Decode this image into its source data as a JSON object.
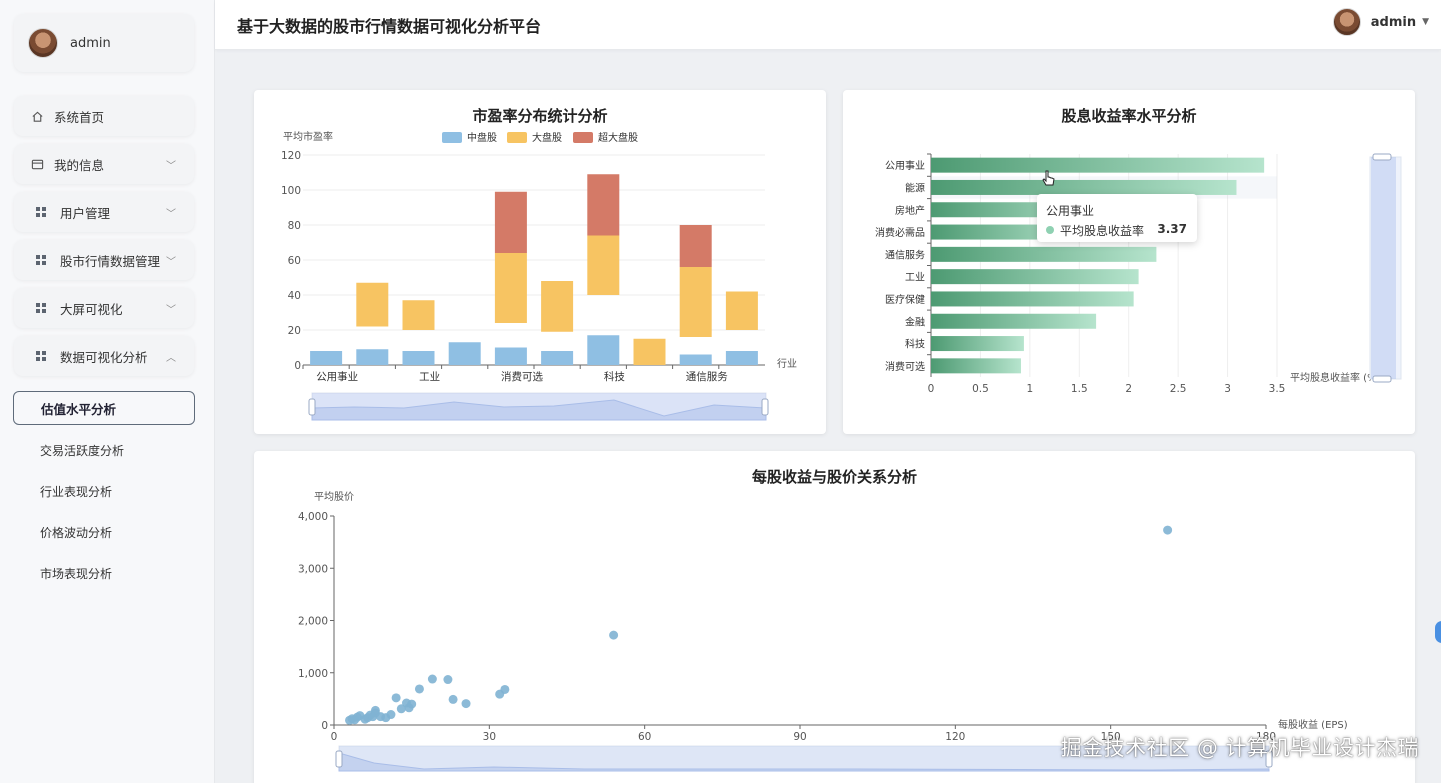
{
  "app": {
    "title": "基于大数据的股市行情数据可视化分析平台"
  },
  "user": {
    "name": "admin"
  },
  "sidebar": {
    "items": [
      {
        "label": "系统首页"
      },
      {
        "label": "我的信息"
      },
      {
        "label": "用户管理"
      },
      {
        "label": "股市行情数据管理"
      },
      {
        "label": "大屏可视化"
      },
      {
        "label": "数据可视化分析"
      }
    ],
    "subitems": [
      {
        "label": "估值水平分析"
      },
      {
        "label": "交易活跃度分析"
      },
      {
        "label": "行业表现分析"
      },
      {
        "label": "价格波动分析"
      },
      {
        "label": "市场表现分析"
      }
    ]
  },
  "tooltip": {
    "title": "公用事业",
    "label": "平均股息收益率",
    "value": "3.37"
  },
  "watermark": "掘金技术社区 @ 计算机毕业设计杰瑞",
  "chart_data": [
    {
      "type": "bar",
      "stacked": true,
      "title": "市盈率分布统计分析",
      "ylabel": "平均市盈率",
      "xlabel": "行业",
      "ylim": [
        0,
        120
      ],
      "yticks": [
        0,
        20,
        40,
        60,
        80,
        100,
        120
      ],
      "xtick_labels": [
        "公用事业",
        "工业",
        "消费可选",
        "科技",
        "通信服务"
      ],
      "legend": [
        "中盘股",
        "大盘股",
        "超大盘股"
      ],
      "colors": [
        "#8fbfe3",
        "#f7c462",
        "#d47a67"
      ],
      "bars": [
        {
          "mid": 8,
          "large": [
            0,
            0
          ],
          "xl": [
            0,
            0
          ]
        },
        {
          "mid": 9,
          "large": [
            22,
            47
          ],
          "xl": [
            0,
            0
          ]
        },
        {
          "mid": 8,
          "large": [
            20,
            37
          ],
          "xl": [
            0,
            0
          ]
        },
        {
          "mid": 13,
          "large": [
            0,
            0
          ],
          "xl": [
            0,
            0
          ]
        },
        {
          "mid": 10,
          "large": [
            24,
            64
          ],
          "xl": [
            64,
            99
          ]
        },
        {
          "mid": 8,
          "large": [
            19,
            48
          ],
          "xl": [
            0,
            0
          ]
        },
        {
          "mid": 17,
          "large": [
            40,
            74
          ],
          "xl": [
            74,
            109
          ]
        },
        {
          "mid": 0,
          "large": [
            0,
            15
          ],
          "xl": [
            0,
            0
          ]
        },
        {
          "mid": 6,
          "large": [
            16,
            56
          ],
          "xl": [
            56,
            80
          ]
        },
        {
          "mid": 8,
          "large": [
            20,
            42
          ],
          "xl": [
            0,
            0
          ]
        }
      ],
      "grid": true,
      "legend_position": "top"
    },
    {
      "type": "bar",
      "orientation": "horizontal",
      "title": "股息收益率水平分析",
      "xlabel": "平均股息收益率 (%)",
      "xlim": [
        0,
        3.5
      ],
      "xticks": [
        0,
        0.5,
        1,
        1.5,
        2,
        2.5,
        3,
        3.5
      ],
      "categories": [
        "公用事业",
        "能源",
        "房地产",
        "消费必需品",
        "通信服务",
        "工业",
        "医疗保健",
        "金融",
        "科技",
        "消费可选"
      ],
      "values": [
        3.37,
        3.09,
        1.75,
        1.55,
        2.28,
        2.1,
        2.05,
        1.67,
        0.94,
        0.91
      ],
      "color_start": "#4d9a72",
      "color_end": "#b6e4cd"
    },
    {
      "type": "scatter",
      "title": "每股收益与股价关系分析",
      "xlabel": "每股收益 (EPS)",
      "ylabel": "平均股价",
      "xlim": [
        0,
        180
      ],
      "ylim": [
        0,
        4000
      ],
      "xticks": [
        0,
        30,
        60,
        90,
        120,
        150,
        180
      ],
      "yticks": [
        0,
        1000,
        2000,
        3000,
        4000
      ],
      "ytick_labels": [
        "0",
        "1,000",
        "2,000",
        "3,000",
        "4,000"
      ],
      "color": "#7fb3d3",
      "points": [
        [
          3,
          90
        ],
        [
          3.5,
          120
        ],
        [
          4,
          100
        ],
        [
          4.5,
          150
        ],
        [
          5,
          180
        ],
        [
          6,
          110
        ],
        [
          6.5,
          140
        ],
        [
          7,
          190
        ],
        [
          7.5,
          160
        ],
        [
          8,
          230
        ],
        [
          8,
          280
        ],
        [
          9,
          160
        ],
        [
          10,
          140
        ],
        [
          11,
          200
        ],
        [
          12,
          520
        ],
        [
          13,
          310
        ],
        [
          14,
          420
        ],
        [
          14.5,
          330
        ],
        [
          15,
          400
        ],
        [
          16.5,
          690
        ],
        [
          19,
          880
        ],
        [
          22,
          870
        ],
        [
          23,
          490
        ],
        [
          25.5,
          410
        ],
        [
          32,
          590
        ],
        [
          33,
          680
        ],
        [
          54,
          1720
        ],
        [
          161,
          3730
        ]
      ]
    }
  ]
}
